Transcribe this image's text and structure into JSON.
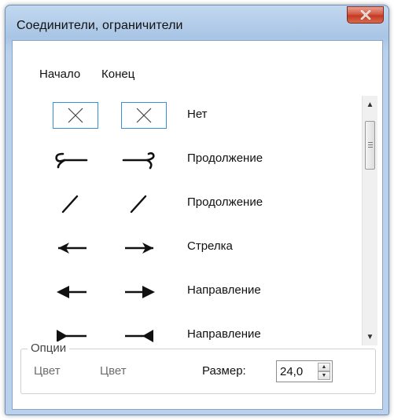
{
  "window": {
    "title": "Соединители, ограничители",
    "close_icon": "close-x-icon"
  },
  "columns": {
    "start": "Начало",
    "end": "Конец"
  },
  "rows": [
    {
      "label": "Нет",
      "start_icon": "none-x-icon",
      "end_icon": "none-x-icon",
      "selected": true
    },
    {
      "label": "Продолжение",
      "start_icon": "hook-continuation-icon",
      "end_icon": "hook-continuation-icon"
    },
    {
      "label": "Продолжение",
      "start_icon": "slash-continuation-icon",
      "end_icon": "slash-continuation-icon"
    },
    {
      "label": "Стрелка",
      "start_icon": "open-arrow-icon",
      "end_icon": "open-arrow-icon"
    },
    {
      "label": "Направление",
      "start_icon": "filled-arrow-icon",
      "end_icon": "filled-arrow-icon"
    },
    {
      "label": "Направление",
      "start_icon": "filled-triangle-cap-icon",
      "end_icon": "filled-triangle-cap-icon"
    }
  ],
  "options": {
    "group_title": "Опции",
    "color_start": "Цвет",
    "color_end": "Цвет",
    "size_label": "Размер:",
    "size_value": "24,0"
  },
  "colors": {
    "selection_border": "#3b8fd9",
    "close_button": "#c23a22"
  }
}
